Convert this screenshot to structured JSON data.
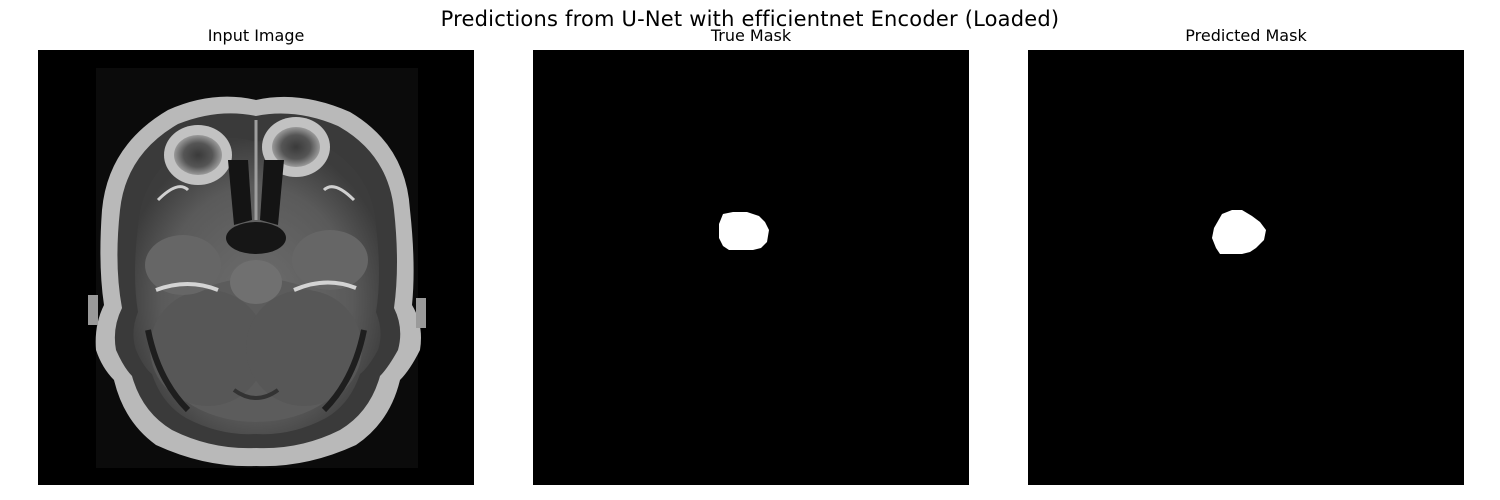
{
  "figure": {
    "suptitle": "Predictions from U-Net with efficientnet Encoder (Loaded)"
  },
  "panels": [
    {
      "title": "Input Image"
    },
    {
      "title": "True Mask"
    },
    {
      "title": "Predicted Mask"
    }
  ],
  "colors": {
    "background": "#ffffff",
    "image_background": "#000000",
    "mask_foreground": "#ffffff"
  }
}
